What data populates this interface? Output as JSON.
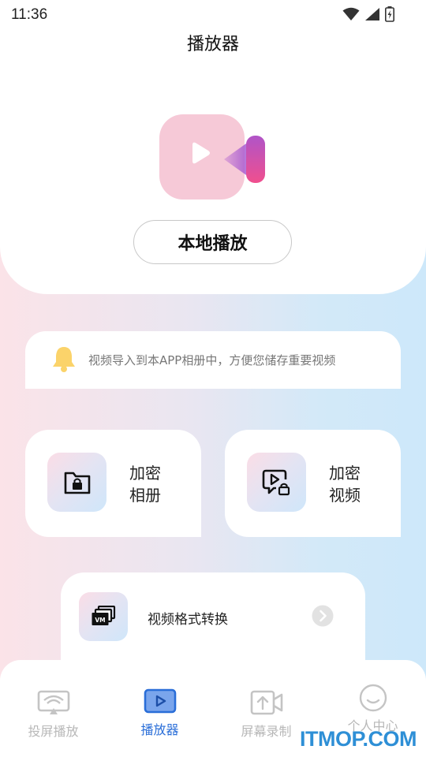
{
  "status_bar": {
    "time": "11:36",
    "icons": [
      "wifi-icon",
      "signal-icon",
      "battery-charging-icon"
    ]
  },
  "header": {
    "title": "播放器"
  },
  "hero": {
    "icon": "video-camera-play-icon",
    "local_play_label": "本地播放"
  },
  "notice": {
    "icon": "bell-icon",
    "text": "视频导入到本APP相册中，方便您储存重要视频"
  },
  "features": [
    {
      "icon": "locked-folder-icon",
      "line1": "加密",
      "line2": "相册"
    },
    {
      "icon": "locked-video-icon",
      "line1": "加密",
      "line2": "视频"
    }
  ],
  "convert": {
    "icon": "video-stack-icon",
    "label": "视频格式转换",
    "arrow_icon": "chevron-right-icon"
  },
  "tabs": [
    {
      "icon": "screen-cast-icon",
      "label": "投屏播放",
      "active": false
    },
    {
      "icon": "player-icon",
      "label": "播放器",
      "active": true
    },
    {
      "icon": "screen-record-icon",
      "label": "屏幕录制",
      "active": false
    },
    {
      "icon": "smiley-icon",
      "label": "个人中心",
      "active": false
    }
  ],
  "watermark": "ITMOP.COM",
  "colors": {
    "accent_blue": "#2a6ed8",
    "inactive_gray": "#b8b8b8",
    "icon_pink": "#f5c8d6",
    "icon_purple": "#9a4fd0",
    "bell_yellow": "#fbd36a"
  }
}
